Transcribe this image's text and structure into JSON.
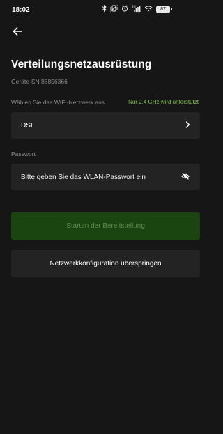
{
  "status_bar": {
    "time": "18:02",
    "bluetooth_icon": "bluetooth-icon",
    "battery_level": "87"
  },
  "header": {
    "back_icon": "arrow-left-icon",
    "title": "Verteilungsnetzausrüstung",
    "device_sn": "Geräte-SN 88856366"
  },
  "wifi": {
    "label": "Wählen Sie das WIFI-Netzwerk aus",
    "hint": "Nur 2,4 GHz wird unterstützt",
    "selected_network": "DSI"
  },
  "password": {
    "label": "Passwort",
    "placeholder": "Bitte geben Sie das WLAN-Passwort ein",
    "value": ""
  },
  "actions": {
    "start_label": "Starten der Bereitstellung",
    "skip_label": "Netzwerkkonfiguration überspringen"
  },
  "colors": {
    "background": "#161616",
    "field": "#232323",
    "accent_green": "#7cc243",
    "start_button_disabled": "#1b4510"
  }
}
